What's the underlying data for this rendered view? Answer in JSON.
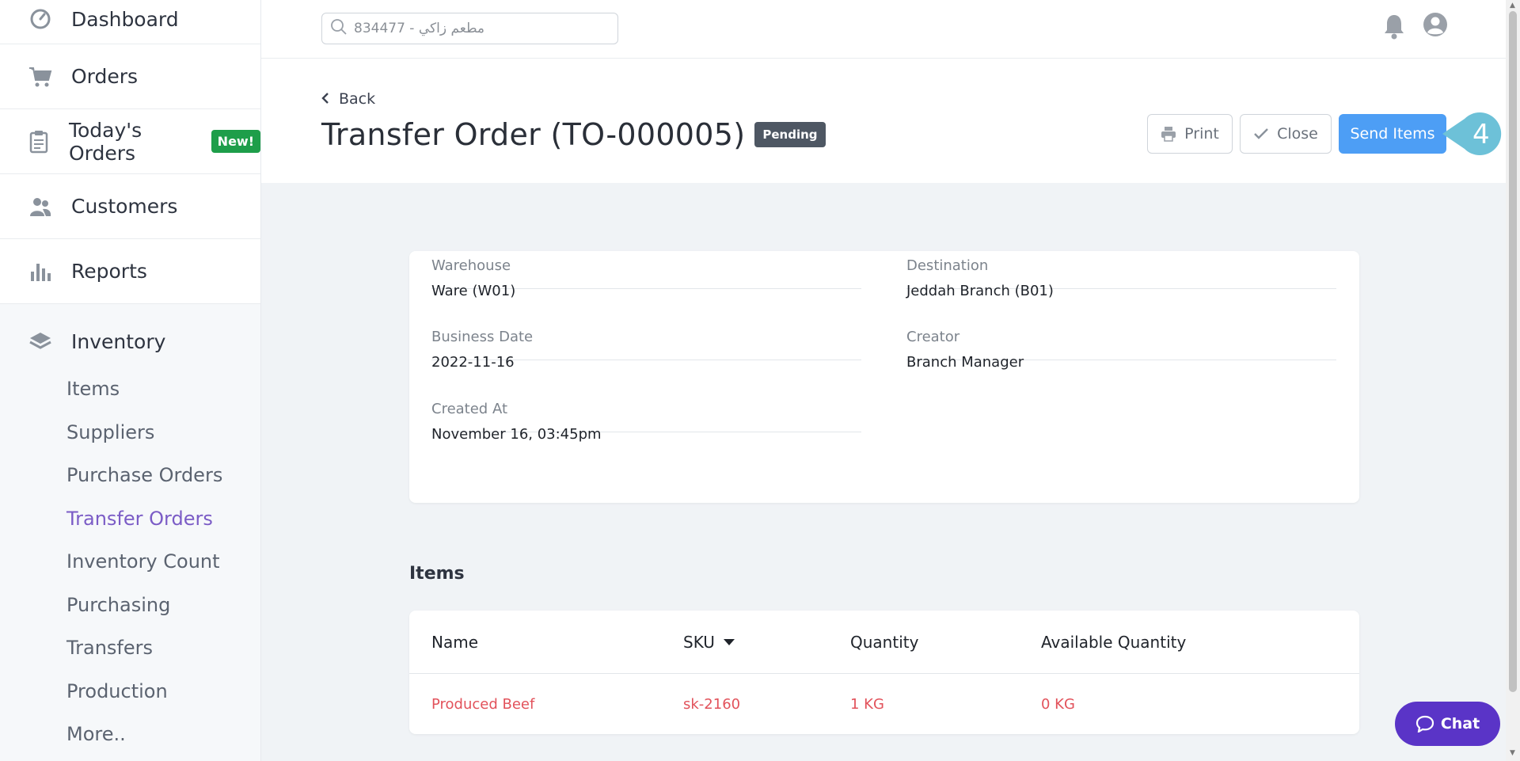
{
  "sidebar": {
    "items": [
      {
        "label": "Dashboard",
        "icon": "gauge-icon"
      },
      {
        "label": "Orders",
        "icon": "cart-icon"
      },
      {
        "label": "Today's Orders",
        "icon": "clipboard-icon",
        "badge": "New!"
      },
      {
        "label": "Customers",
        "icon": "users-icon"
      },
      {
        "label": "Reports",
        "icon": "bar-chart-icon"
      }
    ],
    "inventory": {
      "label": "Inventory",
      "icon": "layers-icon",
      "subitems": [
        "Items",
        "Suppliers",
        "Purchase Orders",
        "Transfer Orders",
        "Inventory Count",
        "Purchasing",
        "Transfers",
        "Production",
        "More.."
      ],
      "active": "Transfer Orders"
    }
  },
  "topbar": {
    "search_placeholder": "مطعم زاكي - 834477"
  },
  "header": {
    "back_label": "Back",
    "title": "Transfer Order (TO-000005)",
    "status": "Pending",
    "print_label": "Print",
    "close_label": "Close",
    "send_label": "Send Items",
    "step_number": "4"
  },
  "details": {
    "warehouse_label": "Warehouse",
    "warehouse_value": "Ware (W01)",
    "destination_label": "Destination",
    "destination_value": "Jeddah Branch (B01)",
    "business_date_label": "Business Date",
    "business_date_value": "2022-11-16",
    "creator_label": "Creator",
    "creator_value": "Branch Manager",
    "created_at_label": "Created At",
    "created_at_value": "November 16, 03:45pm"
  },
  "items": {
    "title": "Items",
    "columns": [
      "Name",
      "SKU",
      "Quantity",
      "Available Quantity"
    ],
    "rows": [
      {
        "name": "Produced Beef",
        "sku": "sk-2160",
        "quantity": "1 KG",
        "available": "0 KG"
      }
    ]
  },
  "chat": {
    "label": "Chat"
  },
  "colors": {
    "accent": "#4d9ef5",
    "active_nav": "#7b5cc6",
    "row_text": "#e2525b",
    "new_badge": "#1e9e4a",
    "chat": "#5a34c7"
  }
}
